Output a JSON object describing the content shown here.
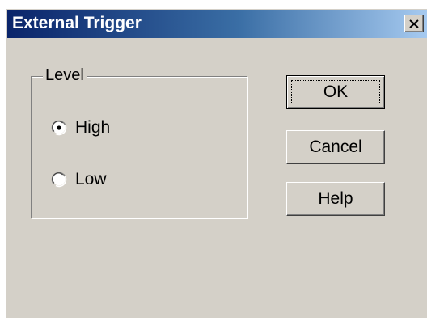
{
  "window": {
    "title": "External Trigger",
    "close_icon": "close-icon",
    "colors": {
      "titlebar_start": "#0a246a",
      "titlebar_end": "#a6caf0",
      "face": "#d4d0c8"
    }
  },
  "level_group": {
    "label": "Level",
    "options": [
      {
        "label": "High",
        "selected": true
      },
      {
        "label": "Low",
        "selected": false
      }
    ]
  },
  "buttons": {
    "ok": "OK",
    "cancel": "Cancel",
    "help": "Help"
  }
}
